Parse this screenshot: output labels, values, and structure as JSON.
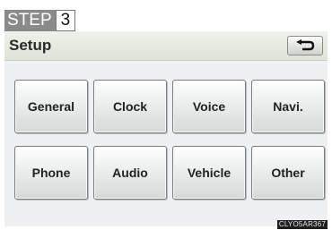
{
  "step": {
    "word": "STEP",
    "number": "3"
  },
  "header": {
    "title": "Setup",
    "back_icon": "return-arrow-icon"
  },
  "menu": {
    "row1": [
      "General",
      "Clock",
      "Voice",
      "Navi."
    ],
    "row2": [
      "Phone",
      "Audio",
      "Vehicle",
      "Other"
    ]
  },
  "figure_code": "CLYO5AR367",
  "colors": {
    "step_bg": "#8a8a8a",
    "screen_bg": "#eef0f2",
    "header_bg": "#dde4d6"
  }
}
